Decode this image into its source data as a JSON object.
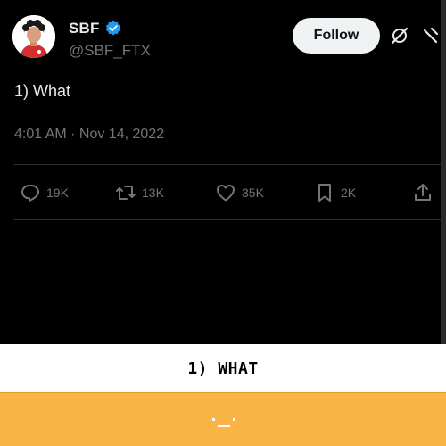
{
  "tweet": {
    "author": {
      "display_name": "SBF",
      "handle": "@SBF_FTX",
      "verified": true,
      "avatar_icon": "user-avatar"
    },
    "follow_label": "Follow",
    "text": "1) What",
    "time": "4:01 AM",
    "separator": " · ",
    "date": "Nov 14, 2022",
    "actions": {
      "replies": "19K",
      "retweets": "13K",
      "likes": "35K",
      "bookmarks": "2K"
    }
  },
  "caption": {
    "text": "1) WHAT"
  },
  "colors": {
    "background": "#000000",
    "verified_badge": "#1d9bf0",
    "follow_button": "#eff3f4",
    "muted_text": "#71767b",
    "caption_bg": "#ffffff",
    "footer_bg": "#f9b443"
  }
}
